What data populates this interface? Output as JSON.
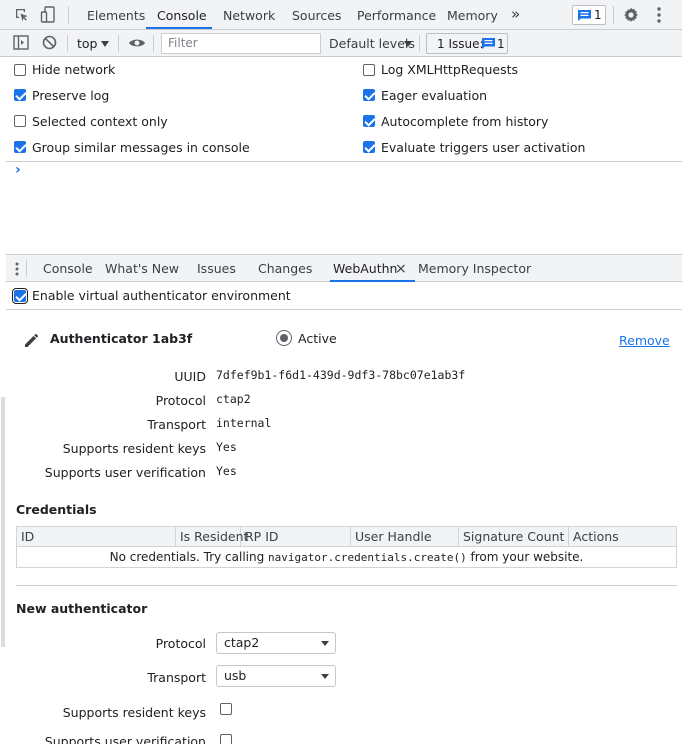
{
  "toolbar": {
    "tabs": [
      "Elements",
      "Console",
      "Network",
      "Sources",
      "Performance",
      "Memory"
    ],
    "more_glyph": "»",
    "badge_count": "1"
  },
  "console_toolbar": {
    "context": "top",
    "filter_placeholder": "Filter",
    "levels": "Default levels",
    "issues_label": "1 Issue:",
    "issues_count": "1"
  },
  "settings": {
    "left": [
      {
        "label": "Hide network",
        "checked": false
      },
      {
        "label": "Preserve log",
        "checked": true
      },
      {
        "label": "Selected context only",
        "checked": false
      },
      {
        "label": "Group similar messages in console",
        "checked": true
      }
    ],
    "right": [
      {
        "label": "Log XMLHttpRequests",
        "checked": false
      },
      {
        "label": "Eager evaluation",
        "checked": true
      },
      {
        "label": "Autocomplete from history",
        "checked": true
      },
      {
        "label": "Evaluate triggers user activation",
        "checked": true
      }
    ]
  },
  "prompt": "›",
  "drawer": {
    "tabs": [
      "Console",
      "What's New",
      "Issues",
      "Changes",
      "WebAuthn",
      "Memory Inspector"
    ],
    "active": "WebAuthn",
    "close_glyph": "×"
  },
  "webauthn": {
    "enable_label": "Enable virtual authenticator environment",
    "enable_checked": true,
    "authenticator": {
      "name": "Authenticator 1ab3f",
      "active_label": "Active",
      "remove_label": "Remove",
      "fields": [
        {
          "label": "UUID",
          "value": "7dfef9b1-f6d1-439d-9df3-78bc07e1ab3f"
        },
        {
          "label": "Protocol",
          "value": "ctap2"
        },
        {
          "label": "Transport",
          "value": "internal"
        },
        {
          "label": "Supports resident keys",
          "value": "Yes"
        },
        {
          "label": "Supports user verification",
          "value": "Yes"
        }
      ]
    },
    "credentials": {
      "title": "Credentials",
      "columns": [
        "ID",
        "Is Resident",
        "RP ID",
        "User Handle",
        "Signature Count",
        "Actions"
      ],
      "empty_pre": "No credentials. Try calling ",
      "empty_code": "navigator.credentials.create()",
      "empty_post": " from your website."
    },
    "new_authenticator": {
      "title": "New authenticator",
      "protocol_label": "Protocol",
      "protocol_value": "ctap2",
      "transport_label": "Transport",
      "transport_value": "usb",
      "resident_label": "Supports resident keys",
      "resident_checked": false,
      "verification_label": "Supports user verification",
      "verification_checked": false
    }
  }
}
